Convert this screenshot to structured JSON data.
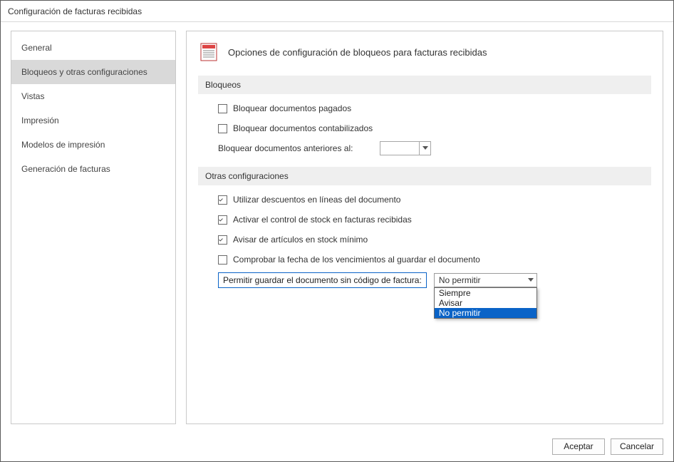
{
  "window": {
    "title": "Configuración de facturas recibidas"
  },
  "sidebar": {
    "items": [
      {
        "label": "General"
      },
      {
        "label": "Bloqueos y otras configuraciones"
      },
      {
        "label": "Vistas"
      },
      {
        "label": "Impresión"
      },
      {
        "label": "Modelos de impresión"
      },
      {
        "label": "Generación de facturas"
      }
    ],
    "selected_index": 1
  },
  "page": {
    "heading": "Opciones de configuración de bloqueos para facturas recibidas",
    "sections": {
      "bloqueos": {
        "title": "Bloqueos",
        "items": {
          "pagados": {
            "label": "Bloquear documentos pagados",
            "checked": false
          },
          "contabilizados": {
            "label": "Bloquear documentos contabilizados",
            "checked": false
          },
          "anteriores": {
            "label": "Bloquear documentos anteriores al:",
            "value": ""
          }
        }
      },
      "otras": {
        "title": "Otras configuraciones",
        "items": {
          "descuentos": {
            "label": "Utilizar descuentos en líneas del documento",
            "checked": true
          },
          "stock": {
            "label": "Activar el control de stock en facturas recibidas",
            "checked": true
          },
          "stock_min": {
            "label": "Avisar de artículos en stock mínimo",
            "checked": true
          },
          "vencimientos": {
            "label": "Comprobar la fecha de los vencimientos al guardar el documento",
            "checked": false
          },
          "permitir": {
            "label": "Permitir guardar el documento sin código de factura:",
            "selected": "No permitir",
            "options": [
              "Siempre",
              "Avisar",
              "No permitir"
            ],
            "selected_index": 2
          }
        }
      }
    }
  },
  "footer": {
    "accept": "Aceptar",
    "cancel": "Cancelar"
  },
  "colors": {
    "highlight": "#0a63c7",
    "selected_bg": "#d9d9d9"
  }
}
